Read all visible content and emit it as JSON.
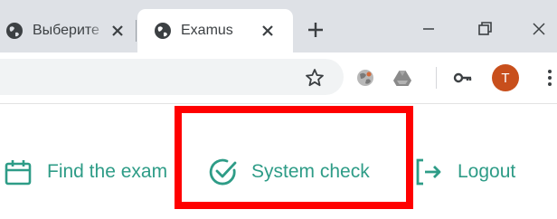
{
  "tabs": [
    {
      "title": "Выберите",
      "favicon": "globe-icon",
      "active": false
    },
    {
      "title": "Examus",
      "favicon": "globe-icon",
      "active": true
    }
  ],
  "toolbar": {
    "icons": [
      "star-icon",
      "globe-extension-icon",
      "google-drive-icon",
      "key-icon",
      "menu-icon"
    ],
    "avatar_initial": "T",
    "avatar_color": "#c84f1c"
  },
  "nav": {
    "items": [
      {
        "label": "Find the exam",
        "icon": "calendar-icon"
      },
      {
        "label": "System check",
        "icon": "check-circle-icon"
      },
      {
        "label": "Logout",
        "icon": "logout-icon"
      }
    ],
    "accent_color": "#2e9c87",
    "highlight_color": "#ff0000"
  }
}
